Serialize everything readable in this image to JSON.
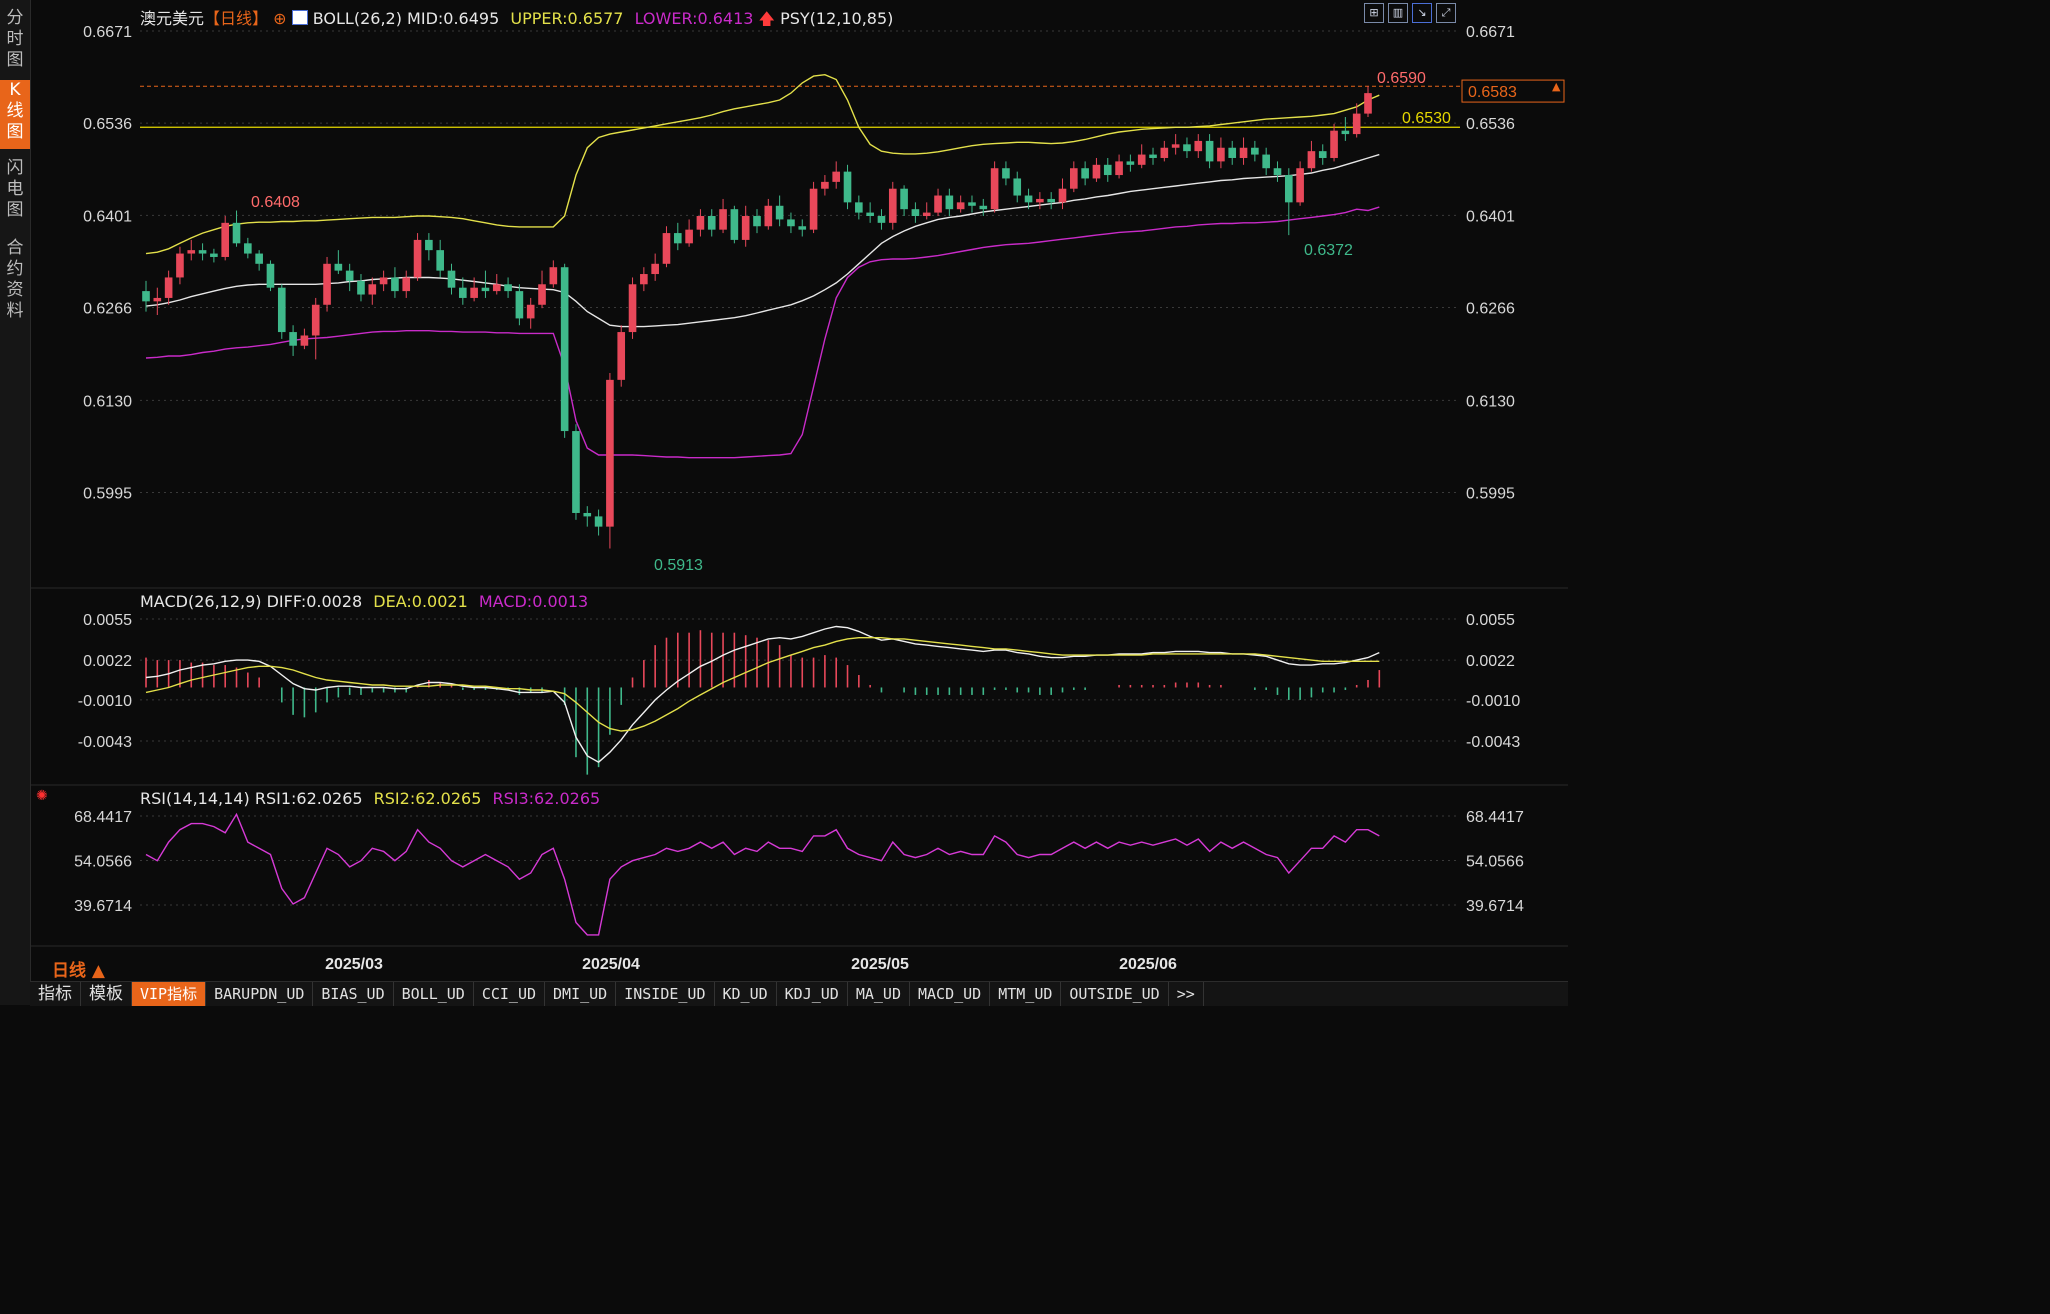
{
  "sidebar": {
    "tabs": [
      {
        "label": "分\n时\n图",
        "active": false
      },
      {
        "label": "K\n线\n图",
        "active": true
      },
      {
        "label": "闪\n电\n图",
        "active": false
      },
      {
        "label": "合\n约\n资\n料",
        "active": false
      }
    ]
  },
  "main": {
    "symbol": "澳元美元",
    "period": "【日线】",
    "boll_name": "BOLL(26,2)",
    "boll_mid": "MID:0.6495",
    "boll_upper": "UPPER:0.6577",
    "boll_lower": "LOWER:0.6413",
    "psy": "PSY(12,10,85)",
    "yticks": [
      "0.6671",
      "0.6536",
      "0.6401",
      "0.6266",
      "0.6130",
      "0.5995"
    ],
    "high_label": "0.6408",
    "low_label": "0.5913",
    "recent_high": "0.6590",
    "recent_low": "0.6372",
    "hline_label": "0.6530",
    "last_price": "0.6583"
  },
  "macd": {
    "name": "MACD(26,12,9)",
    "diff": "DIFF:0.0028",
    "dea": "DEA:0.0021",
    "macd": "MACD:0.0013",
    "yticks": [
      "0.0055",
      "0.0022",
      "-0.0010",
      "-0.0043"
    ]
  },
  "rsi": {
    "name": "RSI(14,14,14)",
    "rsi1": "RSI1:62.0265",
    "rsi2": "RSI2:62.0265",
    "rsi3": "RSI3:62.0265",
    "yticks": [
      "68.4417",
      "54.0566",
      "39.6714"
    ]
  },
  "xaxis": {
    "labels": [
      "2025/03",
      "2025/04",
      "2025/05",
      "2025/06"
    ]
  },
  "period_button": "日线 ▲",
  "bottom_tabs": [
    "指标",
    "模板",
    "VIP指标",
    "BARUPDN_UD",
    "BIAS_UD",
    "BOLL_UD",
    "CCI_UD",
    "DMI_UD",
    "INSIDE_UD",
    "KD_UD",
    "KDJ_UD",
    "MA_UD",
    "MACD_UD",
    "MTM_UD",
    "OUTSIDE_UD",
    ">>"
  ],
  "colors": {
    "up": "#e8485a",
    "down": "#3fb98b",
    "mid": "#e6e6e6",
    "upper": "#e3e04a",
    "lower": "#c92bc9",
    "hline": "#e6d800",
    "accent": "#e8651a"
  },
  "chart_data": {
    "type": "candlestick",
    "title": "澳元美元 日线",
    "ylim": [
      0.5935,
      0.671
    ],
    "indicator_lines": {
      "hline": 0.653,
      "recent_high": 0.659,
      "last_price": 0.6583
    },
    "candles": [
      [
        0.629,
        0.6275,
        0.6305,
        0.626
      ],
      [
        0.6275,
        0.628,
        0.6295,
        0.6255
      ],
      [
        0.628,
        0.631,
        0.632,
        0.627
      ],
      [
        0.631,
        0.6345,
        0.6355,
        0.63
      ],
      [
        0.6345,
        0.635,
        0.6365,
        0.6335
      ],
      [
        0.635,
        0.6345,
        0.636,
        0.6335
      ],
      [
        0.6345,
        0.634,
        0.6352,
        0.6332
      ],
      [
        0.634,
        0.639,
        0.64,
        0.6335
      ],
      [
        0.639,
        0.636,
        0.6408,
        0.6355
      ],
      [
        0.636,
        0.6345,
        0.6368,
        0.6338
      ],
      [
        0.6345,
        0.633,
        0.635,
        0.632
      ],
      [
        0.633,
        0.6295,
        0.6335,
        0.629
      ],
      [
        0.6295,
        0.623,
        0.63,
        0.622
      ],
      [
        0.623,
        0.621,
        0.624,
        0.6195
      ],
      [
        0.621,
        0.6225,
        0.6235,
        0.6205
      ],
      [
        0.6225,
        0.627,
        0.628,
        0.619
      ],
      [
        0.627,
        0.633,
        0.634,
        0.626
      ],
      [
        0.633,
        0.632,
        0.635,
        0.6315
      ],
      [
        0.632,
        0.6305,
        0.633,
        0.629
      ],
      [
        0.6305,
        0.6285,
        0.6315,
        0.6275
      ],
      [
        0.6285,
        0.63,
        0.631,
        0.627
      ],
      [
        0.63,
        0.631,
        0.632,
        0.629
      ],
      [
        0.631,
        0.629,
        0.6325,
        0.628
      ],
      [
        0.629,
        0.631,
        0.632,
        0.628
      ],
      [
        0.631,
        0.6365,
        0.6375,
        0.6305
      ],
      [
        0.6365,
        0.635,
        0.6375,
        0.6335
      ],
      [
        0.635,
        0.632,
        0.6365,
        0.631
      ],
      [
        0.632,
        0.6295,
        0.633,
        0.6285
      ],
      [
        0.6295,
        0.628,
        0.631,
        0.627
      ],
      [
        0.628,
        0.6295,
        0.631,
        0.6275
      ],
      [
        0.6295,
        0.629,
        0.632,
        0.628
      ],
      [
        0.629,
        0.63,
        0.6315,
        0.6285
      ],
      [
        0.63,
        0.629,
        0.631,
        0.628
      ],
      [
        0.629,
        0.625,
        0.63,
        0.624
      ],
      [
        0.625,
        0.627,
        0.628,
        0.6235
      ],
      [
        0.627,
        0.63,
        0.632,
        0.6265
      ],
      [
        0.63,
        0.6325,
        0.6335,
        0.6295
      ],
      [
        0.6325,
        0.6085,
        0.633,
        0.6075
      ],
      [
        0.6085,
        0.5965,
        0.6095,
        0.5955
      ],
      [
        0.5965,
        0.596,
        0.5975,
        0.5945
      ],
      [
        0.596,
        0.5945,
        0.597,
        0.5932
      ],
      [
        0.5945,
        0.616,
        0.617,
        0.5913
      ],
      [
        0.616,
        0.623,
        0.624,
        0.615
      ],
      [
        0.623,
        0.63,
        0.631,
        0.622
      ],
      [
        0.63,
        0.6315,
        0.6325,
        0.629
      ],
      [
        0.6315,
        0.633,
        0.6345,
        0.6305
      ],
      [
        0.633,
        0.6375,
        0.6385,
        0.6325
      ],
      [
        0.6375,
        0.636,
        0.639,
        0.635
      ],
      [
        0.636,
        0.638,
        0.6395,
        0.6355
      ],
      [
        0.638,
        0.64,
        0.641,
        0.637
      ],
      [
        0.64,
        0.638,
        0.641,
        0.637
      ],
      [
        0.638,
        0.641,
        0.6425,
        0.6375
      ],
      [
        0.641,
        0.6365,
        0.6415,
        0.636
      ],
      [
        0.6365,
        0.64,
        0.6415,
        0.6355
      ],
      [
        0.64,
        0.6385,
        0.641,
        0.6375
      ],
      [
        0.6385,
        0.6415,
        0.6425,
        0.638
      ],
      [
        0.6415,
        0.6395,
        0.643,
        0.6385
      ],
      [
        0.6395,
        0.6385,
        0.6405,
        0.6375
      ],
      [
        0.6385,
        0.638,
        0.6395,
        0.637
      ],
      [
        0.638,
        0.644,
        0.645,
        0.6375
      ],
      [
        0.644,
        0.645,
        0.646,
        0.643
      ],
      [
        0.645,
        0.6465,
        0.648,
        0.644
      ],
      [
        0.6465,
        0.642,
        0.6475,
        0.641
      ],
      [
        0.642,
        0.6405,
        0.643,
        0.6395
      ],
      [
        0.6405,
        0.64,
        0.642,
        0.639
      ],
      [
        0.64,
        0.639,
        0.641,
        0.638
      ],
      [
        0.639,
        0.644,
        0.645,
        0.638
      ],
      [
        0.644,
        0.641,
        0.6445,
        0.64
      ],
      [
        0.641,
        0.64,
        0.642,
        0.639
      ],
      [
        0.64,
        0.6405,
        0.642,
        0.6395
      ],
      [
        0.6405,
        0.643,
        0.644,
        0.64
      ],
      [
        0.643,
        0.641,
        0.644,
        0.64
      ],
      [
        0.641,
        0.642,
        0.643,
        0.6405
      ],
      [
        0.642,
        0.6415,
        0.643,
        0.6405
      ],
      [
        0.6415,
        0.641,
        0.6425,
        0.64
      ],
      [
        0.641,
        0.647,
        0.648,
        0.6405
      ],
      [
        0.647,
        0.6455,
        0.648,
        0.6445
      ],
      [
        0.6455,
        0.643,
        0.6465,
        0.642
      ],
      [
        0.643,
        0.642,
        0.644,
        0.641
      ],
      [
        0.642,
        0.6425,
        0.6435,
        0.641
      ],
      [
        0.6425,
        0.642,
        0.6435,
        0.641
      ],
      [
        0.642,
        0.644,
        0.6455,
        0.641
      ],
      [
        0.644,
        0.647,
        0.648,
        0.6435
      ],
      [
        0.647,
        0.6455,
        0.648,
        0.6445
      ],
      [
        0.6455,
        0.6475,
        0.6485,
        0.645
      ],
      [
        0.6475,
        0.646,
        0.6485,
        0.645
      ],
      [
        0.646,
        0.648,
        0.649,
        0.6455
      ],
      [
        0.648,
        0.6475,
        0.649,
        0.6465
      ],
      [
        0.6475,
        0.649,
        0.6505,
        0.647
      ],
      [
        0.649,
        0.6485,
        0.65,
        0.6475
      ],
      [
        0.6485,
        0.65,
        0.651,
        0.648
      ],
      [
        0.65,
        0.6505,
        0.652,
        0.649
      ],
      [
        0.6505,
        0.6495,
        0.6515,
        0.6485
      ],
      [
        0.6495,
        0.651,
        0.652,
        0.6485
      ],
      [
        0.651,
        0.648,
        0.652,
        0.647
      ],
      [
        0.648,
        0.65,
        0.6515,
        0.647
      ],
      [
        0.65,
        0.6485,
        0.651,
        0.6475
      ],
      [
        0.6485,
        0.65,
        0.6515,
        0.6475
      ],
      [
        0.65,
        0.649,
        0.651,
        0.648
      ],
      [
        0.649,
        0.647,
        0.65,
        0.646
      ],
      [
        0.647,
        0.646,
        0.648,
        0.645
      ],
      [
        0.646,
        0.642,
        0.647,
        0.6372
      ],
      [
        0.642,
        0.647,
        0.648,
        0.6415
      ],
      [
        0.647,
        0.6495,
        0.651,
        0.6465
      ],
      [
        0.6495,
        0.6485,
        0.6505,
        0.6475
      ],
      [
        0.6485,
        0.6525,
        0.6535,
        0.648
      ],
      [
        0.6525,
        0.652,
        0.6545,
        0.651
      ],
      [
        0.652,
        0.655,
        0.6565,
        0.6515
      ],
      [
        0.655,
        0.658,
        0.659,
        0.6545
      ]
    ],
    "boll_mid": [
      0.6268,
      0.627,
      0.6273,
      0.6277,
      0.6282,
      0.6286,
      0.629,
      0.6294,
      0.6297,
      0.6299,
      0.63,
      0.63,
      0.63,
      0.63,
      0.63,
      0.63,
      0.6301,
      0.6302,
      0.6304,
      0.6305,
      0.6307,
      0.6308,
      0.6309,
      0.631,
      0.631,
      0.631,
      0.6309,
      0.6308,
      0.6306,
      0.6304,
      0.6302,
      0.63,
      0.6297,
      0.6295,
      0.6294,
      0.6293,
      0.6292,
      0.6288,
      0.6275,
      0.626,
      0.625,
      0.624,
      0.6238,
      0.6238,
      0.6238,
      0.6239,
      0.624,
      0.6241,
      0.6243,
      0.6245,
      0.6247,
      0.6249,
      0.6251,
      0.6254,
      0.6258,
      0.6262,
      0.6266,
      0.627,
      0.6276,
      0.6283,
      0.6292,
      0.6302,
      0.6315,
      0.633,
      0.6345,
      0.636,
      0.637,
      0.6378,
      0.6385,
      0.639,
      0.6395,
      0.6398,
      0.64,
      0.6403,
      0.6406,
      0.6408,
      0.641,
      0.6412,
      0.6414,
      0.6416,
      0.6418,
      0.642,
      0.6423,
      0.6425,
      0.6428,
      0.643,
      0.6433,
      0.6436,
      0.6438,
      0.644,
      0.6442,
      0.6444,
      0.6446,
      0.6448,
      0.645,
      0.6452,
      0.6453,
      0.6455,
      0.6456,
      0.6457,
      0.6458,
      0.6459,
      0.6461,
      0.6463,
      0.6467,
      0.647,
      0.6475,
      0.648,
      0.6485,
      0.649
    ],
    "boll_upper": [
      0.6345,
      0.6347,
      0.6352,
      0.636,
      0.6368,
      0.6375,
      0.638,
      0.6385,
      0.6388,
      0.639,
      0.6391,
      0.6391,
      0.6392,
      0.6392,
      0.6393,
      0.6393,
      0.6394,
      0.6395,
      0.6396,
      0.6397,
      0.6398,
      0.6398,
      0.6398,
      0.6399,
      0.64,
      0.64,
      0.6399,
      0.6398,
      0.6396,
      0.6393,
      0.639,
      0.6387,
      0.6385,
      0.6384,
      0.6384,
      0.6384,
      0.6384,
      0.64,
      0.646,
      0.65,
      0.6515,
      0.652,
      0.6523,
      0.6526,
      0.6529,
      0.6532,
      0.6535,
      0.6538,
      0.6541,
      0.6544,
      0.6548,
      0.6553,
      0.6557,
      0.656,
      0.6563,
      0.6566,
      0.657,
      0.658,
      0.6595,
      0.6605,
      0.6607,
      0.66,
      0.657,
      0.653,
      0.6505,
      0.6495,
      0.6492,
      0.6491,
      0.6491,
      0.6492,
      0.6494,
      0.6497,
      0.65,
      0.6503,
      0.6505,
      0.6506,
      0.6507,
      0.6508,
      0.6508,
      0.6507,
      0.6506,
      0.6507,
      0.6509,
      0.6512,
      0.6516,
      0.652,
      0.6523,
      0.6525,
      0.6527,
      0.6528,
      0.6529,
      0.653,
      0.653,
      0.6531,
      0.6532,
      0.6534,
      0.6536,
      0.6538,
      0.654,
      0.6542,
      0.6543,
      0.6544,
      0.6545,
      0.6546,
      0.6548,
      0.655,
      0.6555,
      0.656,
      0.657,
      0.6577
    ],
    "boll_lower": [
      0.6192,
      0.6193,
      0.6195,
      0.6195,
      0.6197,
      0.62,
      0.6202,
      0.6205,
      0.6207,
      0.6208,
      0.621,
      0.6212,
      0.6215,
      0.6218,
      0.622,
      0.6221,
      0.6222,
      0.6224,
      0.6226,
      0.6228,
      0.623,
      0.6231,
      0.6231,
      0.6232,
      0.6232,
      0.6232,
      0.6231,
      0.6231,
      0.623,
      0.623,
      0.623,
      0.6229,
      0.6229,
      0.6228,
      0.6228,
      0.6228,
      0.6228,
      0.618,
      0.61,
      0.606,
      0.605,
      0.605,
      0.605,
      0.605,
      0.6049,
      0.6048,
      0.6047,
      0.6047,
      0.6046,
      0.6046,
      0.6046,
      0.6046,
      0.6046,
      0.6047,
      0.6048,
      0.6049,
      0.605,
      0.6052,
      0.608,
      0.615,
      0.622,
      0.628,
      0.631,
      0.6325,
      0.6333,
      0.6336,
      0.6337,
      0.6337,
      0.6338,
      0.634,
      0.6342,
      0.6345,
      0.6348,
      0.6351,
      0.6354,
      0.6356,
      0.6358,
      0.6359,
      0.636,
      0.6362,
      0.6364,
      0.6366,
      0.6368,
      0.637,
      0.6372,
      0.6374,
      0.6376,
      0.6377,
      0.6378,
      0.638,
      0.6382,
      0.6384,
      0.6385,
      0.6387,
      0.6388,
      0.6389,
      0.6389,
      0.639,
      0.639,
      0.6391,
      0.6392,
      0.6394,
      0.6396,
      0.6398,
      0.64,
      0.6402,
      0.6405,
      0.641,
      0.6408,
      0.6413
    ],
    "macd_diff": [
      0.0008,
      0.0009,
      0.0011,
      0.0014,
      0.0016,
      0.0018,
      0.0019,
      0.0021,
      0.0022,
      0.0022,
      0.0021,
      0.0017,
      0.001,
      0.0003,
      -0.0001,
      -0.0002,
      0.0,
      0.0001,
      0.0001,
      0.0,
      0.0,
      0.0,
      -0.0001,
      -0.0001,
      0.0002,
      0.0004,
      0.0004,
      0.0003,
      0.0001,
      0.0,
      0.0,
      -0.0001,
      -0.0002,
      -0.0004,
      -0.0004,
      -0.0004,
      -0.0003,
      -0.0012,
      -0.004,
      -0.0055,
      -0.006,
      -0.0052,
      -0.0042,
      -0.003,
      -0.002,
      -0.001,
      -0.0002,
      0.0005,
      0.0011,
      0.0017,
      0.0021,
      0.0026,
      0.003,
      0.0033,
      0.0036,
      0.0039,
      0.004,
      0.0039,
      0.0041,
      0.0044,
      0.0047,
      0.0049,
      0.0048,
      0.0045,
      0.0041,
      0.0038,
      0.0039,
      0.0037,
      0.0035,
      0.0034,
      0.0033,
      0.0032,
      0.0031,
      0.003,
      0.0029,
      0.003,
      0.003,
      0.0028,
      0.0027,
      0.0025,
      0.0024,
      0.0024,
      0.0025,
      0.0025,
      0.0026,
      0.0026,
      0.0027,
      0.0027,
      0.0027,
      0.0028,
      0.0028,
      0.0029,
      0.0029,
      0.0029,
      0.0028,
      0.0028,
      0.0027,
      0.0027,
      0.0026,
      0.0025,
      0.0022,
      0.0019,
      0.0018,
      0.0018,
      0.0019,
      0.0019,
      0.002,
      0.0022,
      0.0024,
      0.0028
    ],
    "macd_dea": [
      -0.0004,
      -0.0002,
      0.0,
      0.0003,
      0.0006,
      0.0008,
      0.001,
      0.0012,
      0.0014,
      0.0016,
      0.0017,
      0.0017,
      0.0016,
      0.0014,
      0.0011,
      0.0008,
      0.0006,
      0.0005,
      0.0004,
      0.0003,
      0.0002,
      0.0002,
      0.0001,
      0.0001,
      0.0001,
      0.0001,
      0.0002,
      0.0002,
      0.0002,
      0.0001,
      0.0001,
      0.0,
      -0.0001,
      -0.0001,
      -0.0002,
      -0.0002,
      -0.0003,
      -0.0005,
      -0.0012,
      -0.002,
      -0.0028,
      -0.0033,
      -0.0035,
      -0.0034,
      -0.0031,
      -0.0027,
      -0.0022,
      -0.0017,
      -0.0011,
      -0.0006,
      -0.0001,
      0.0004,
      0.0008,
      0.0012,
      0.0016,
      0.002,
      0.0023,
      0.0026,
      0.0029,
      0.0032,
      0.0034,
      0.0037,
      0.0039,
      0.004,
      0.004,
      0.004,
      0.0039,
      0.0039,
      0.0038,
      0.0037,
      0.0036,
      0.0035,
      0.0034,
      0.0033,
      0.0032,
      0.0031,
      0.0031,
      0.003,
      0.0029,
      0.0028,
      0.0027,
      0.0026,
      0.0026,
      0.0026,
      0.0026,
      0.0026,
      0.0026,
      0.0026,
      0.0026,
      0.0027,
      0.0027,
      0.0027,
      0.0027,
      0.0027,
      0.0027,
      0.0027,
      0.0027,
      0.0027,
      0.0027,
      0.0026,
      0.0025,
      0.0024,
      0.0023,
      0.0022,
      0.0021,
      0.0021,
      0.0021,
      0.0021,
      0.0021,
      0.0021
    ],
    "rsi": [
      56,
      54,
      60,
      64,
      66,
      66,
      65,
      63,
      69,
      60,
      58,
      56,
      45,
      40,
      42,
      50,
      58,
      56,
      52,
      54,
      58,
      57,
      54,
      57,
      64,
      60,
      58,
      54,
      52,
      54,
      56,
      54,
      52,
      48,
      50,
      56,
      58,
      48,
      34,
      30,
      30,
      48,
      52,
      54,
      55,
      56,
      58,
      57,
      58,
      60,
      58,
      60,
      56,
      58,
      57,
      60,
      58,
      58,
      57,
      62,
      62,
      64,
      58,
      56,
      55,
      54,
      60,
      56,
      55,
      56,
      58,
      56,
      57,
      56,
      56,
      62,
      60,
      56,
      55,
      56,
      56,
      58,
      60,
      58,
      60,
      58,
      60,
      59,
      60,
      59,
      60,
      61,
      59,
      61,
      57,
      60,
      58,
      60,
      58,
      56,
      55,
      50,
      54,
      58,
      58,
      62,
      60,
      64,
      64,
      62
    ]
  }
}
